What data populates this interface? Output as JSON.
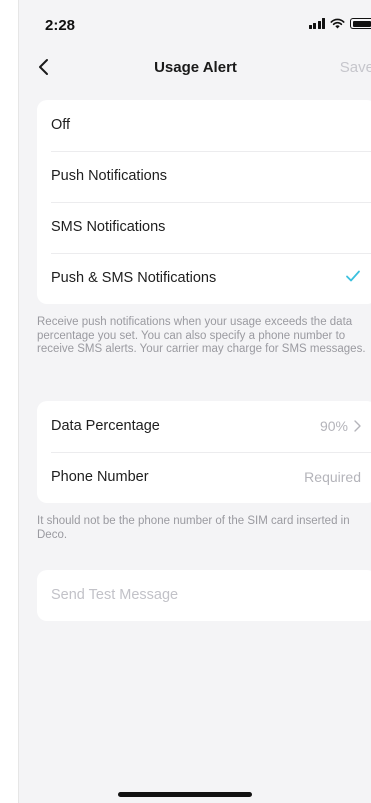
{
  "status_bar": {
    "time": "2:28",
    "icons": [
      "signal-icon",
      "wifi-icon",
      "battery-icon"
    ]
  },
  "nav": {
    "back_icon": "chevron-left-icon",
    "title": "Usage Alert",
    "save_label": "Save"
  },
  "alert_options": {
    "items": [
      {
        "label": "Off",
        "selected": false
      },
      {
        "label": "Push Notifications",
        "selected": false
      },
      {
        "label": "SMS Notifications",
        "selected": false
      },
      {
        "label": "Push & SMS Notifications",
        "selected": true
      }
    ],
    "note": "Receive push notifications when your usage exceeds the data percentage you set. You can also specify a phone number to receive SMS alerts. Your carrier may charge for SMS messages."
  },
  "settings": {
    "data_percentage": {
      "label": "Data Percentage",
      "value": "90%"
    },
    "phone_number": {
      "label": "Phone Number",
      "value": "Required"
    },
    "note": "It should not be the phone number of the SIM card inserted in Deco."
  },
  "test": {
    "label": "Send Test Message"
  },
  "colors": {
    "accent": "#3cc0de",
    "background": "#f4f4f6",
    "disabled_text": "#c2c2c8"
  }
}
